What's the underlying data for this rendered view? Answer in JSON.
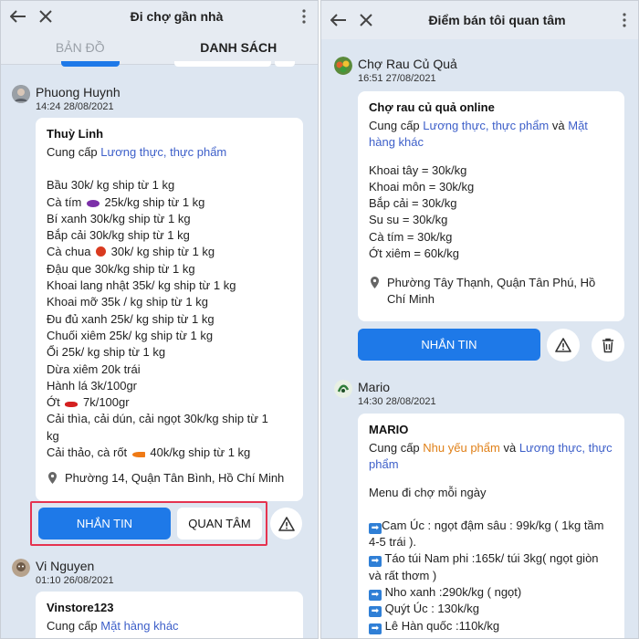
{
  "left": {
    "header": {
      "title": "Đi chợ gần nhà"
    },
    "tabs": [
      {
        "label": "BẢN ĐỒ"
      },
      {
        "label": "DANH SÁCH"
      }
    ],
    "post1": {
      "user": "Phuong Huynh",
      "time": "14:24 28/08/2021",
      "card_title": "Thuỳ Linh",
      "supply_prefix": "Cung cấp",
      "supply_category": "Lương thực, thực phẩm",
      "items": [
        "Bầu 30k/ kg ship từ 1 kg",
        "Cà tím 25k/kg ship từ 1 kg",
        "Bí xanh 30k/kg ship từ 1 kg",
        "Bắp cải 30k/kg ship từ 1 kg",
        "Cà chua 30k/ kg ship từ 1 kg",
        "Đậu que 30k/kg ship từ 1 kg",
        "Khoai lang nhật 35k/ kg ship từ 1 kg",
        "Khoai mỡ 35k / kg ship từ 1 kg",
        "Đu đủ xanh 25k/ kg ship từ 1 kg",
        "Chuối xiêm 25k/ kg ship từ 1 kg",
        "Ổi 25k/ kg ship từ 1 kg",
        "Dừa xiêm 20k trái",
        "Hành lá 3k/100gr",
        "Ớt 7k/100gr",
        "Cải thìa, cải dún, cải ngọt 30k/kg ship từ 1",
        "kg",
        "Cải thảo, cà rốt 40k/kg ship từ 1 kg"
      ],
      "location": "Phường 14, Quận Tân Bình, Hồ Chí Minh",
      "btn_message": "NHẮN TIN",
      "btn_follow": "QUAN TÂM"
    },
    "post2": {
      "user": "Vi Nguyen",
      "time": "01:10 26/08/2021",
      "card_title": "Vinstore123",
      "supply_prefix": "Cung cấp",
      "supply_category": "Mặt hàng khác"
    }
  },
  "right": {
    "header": {
      "title": "Điểm bán tôi quan tâm"
    },
    "post1": {
      "user": "Chợ Rau Củ Quả",
      "time": "16:51 27/08/2021",
      "card_title": "Chợ rau củ quả online",
      "supply_prefix": "Cung cấp",
      "supply_category": "Lương thực, thực phẩm",
      "supply_and": "và",
      "supply_category2": "Mặt hàng khác",
      "items": [
        "Khoai tây = 30k/kg",
        "Khoai môn = 30k/kg",
        "Bắp cải = 30k/kg",
        "Su su = 30k/kg",
        "Cà tím = 30k/kg",
        "Ớt xiêm = 60k/kg"
      ],
      "location": "Phường Tây Thạnh, Quận Tân Phú, Hồ Chí Minh",
      "btn_message": "NHẮN TIN"
    },
    "post2": {
      "user": "Mario",
      "time": "14:30 28/08/2021",
      "card_title": "MARIO",
      "supply_prefix": "Cung cấp",
      "supply_category": "Nhu yếu phẩm",
      "supply_and": "và",
      "supply_category2": "Lương thực, thực phẩm",
      "intro": "Menu đi chợ mỗi ngày",
      "items": [
        "Cam Úc : ngọt đậm sâu : 99k/kg ( 1kg tầm 4-5 trái ).",
        "Táo túi Nam phi :165k/ túi 3kg( ngọt giòn và rất thơm )",
        "Nho xanh :290k/kg (  ngọt)",
        "Quýt Úc : 130k/kg",
        "Lê Hàn quốc :110k/kg"
      ]
    }
  },
  "colors": {
    "primary": "#1e79e8",
    "link": "#3d5fc9",
    "link_orange": "#e08018",
    "highlight": "#e53350",
    "panel_bg": "#dde6f1"
  }
}
